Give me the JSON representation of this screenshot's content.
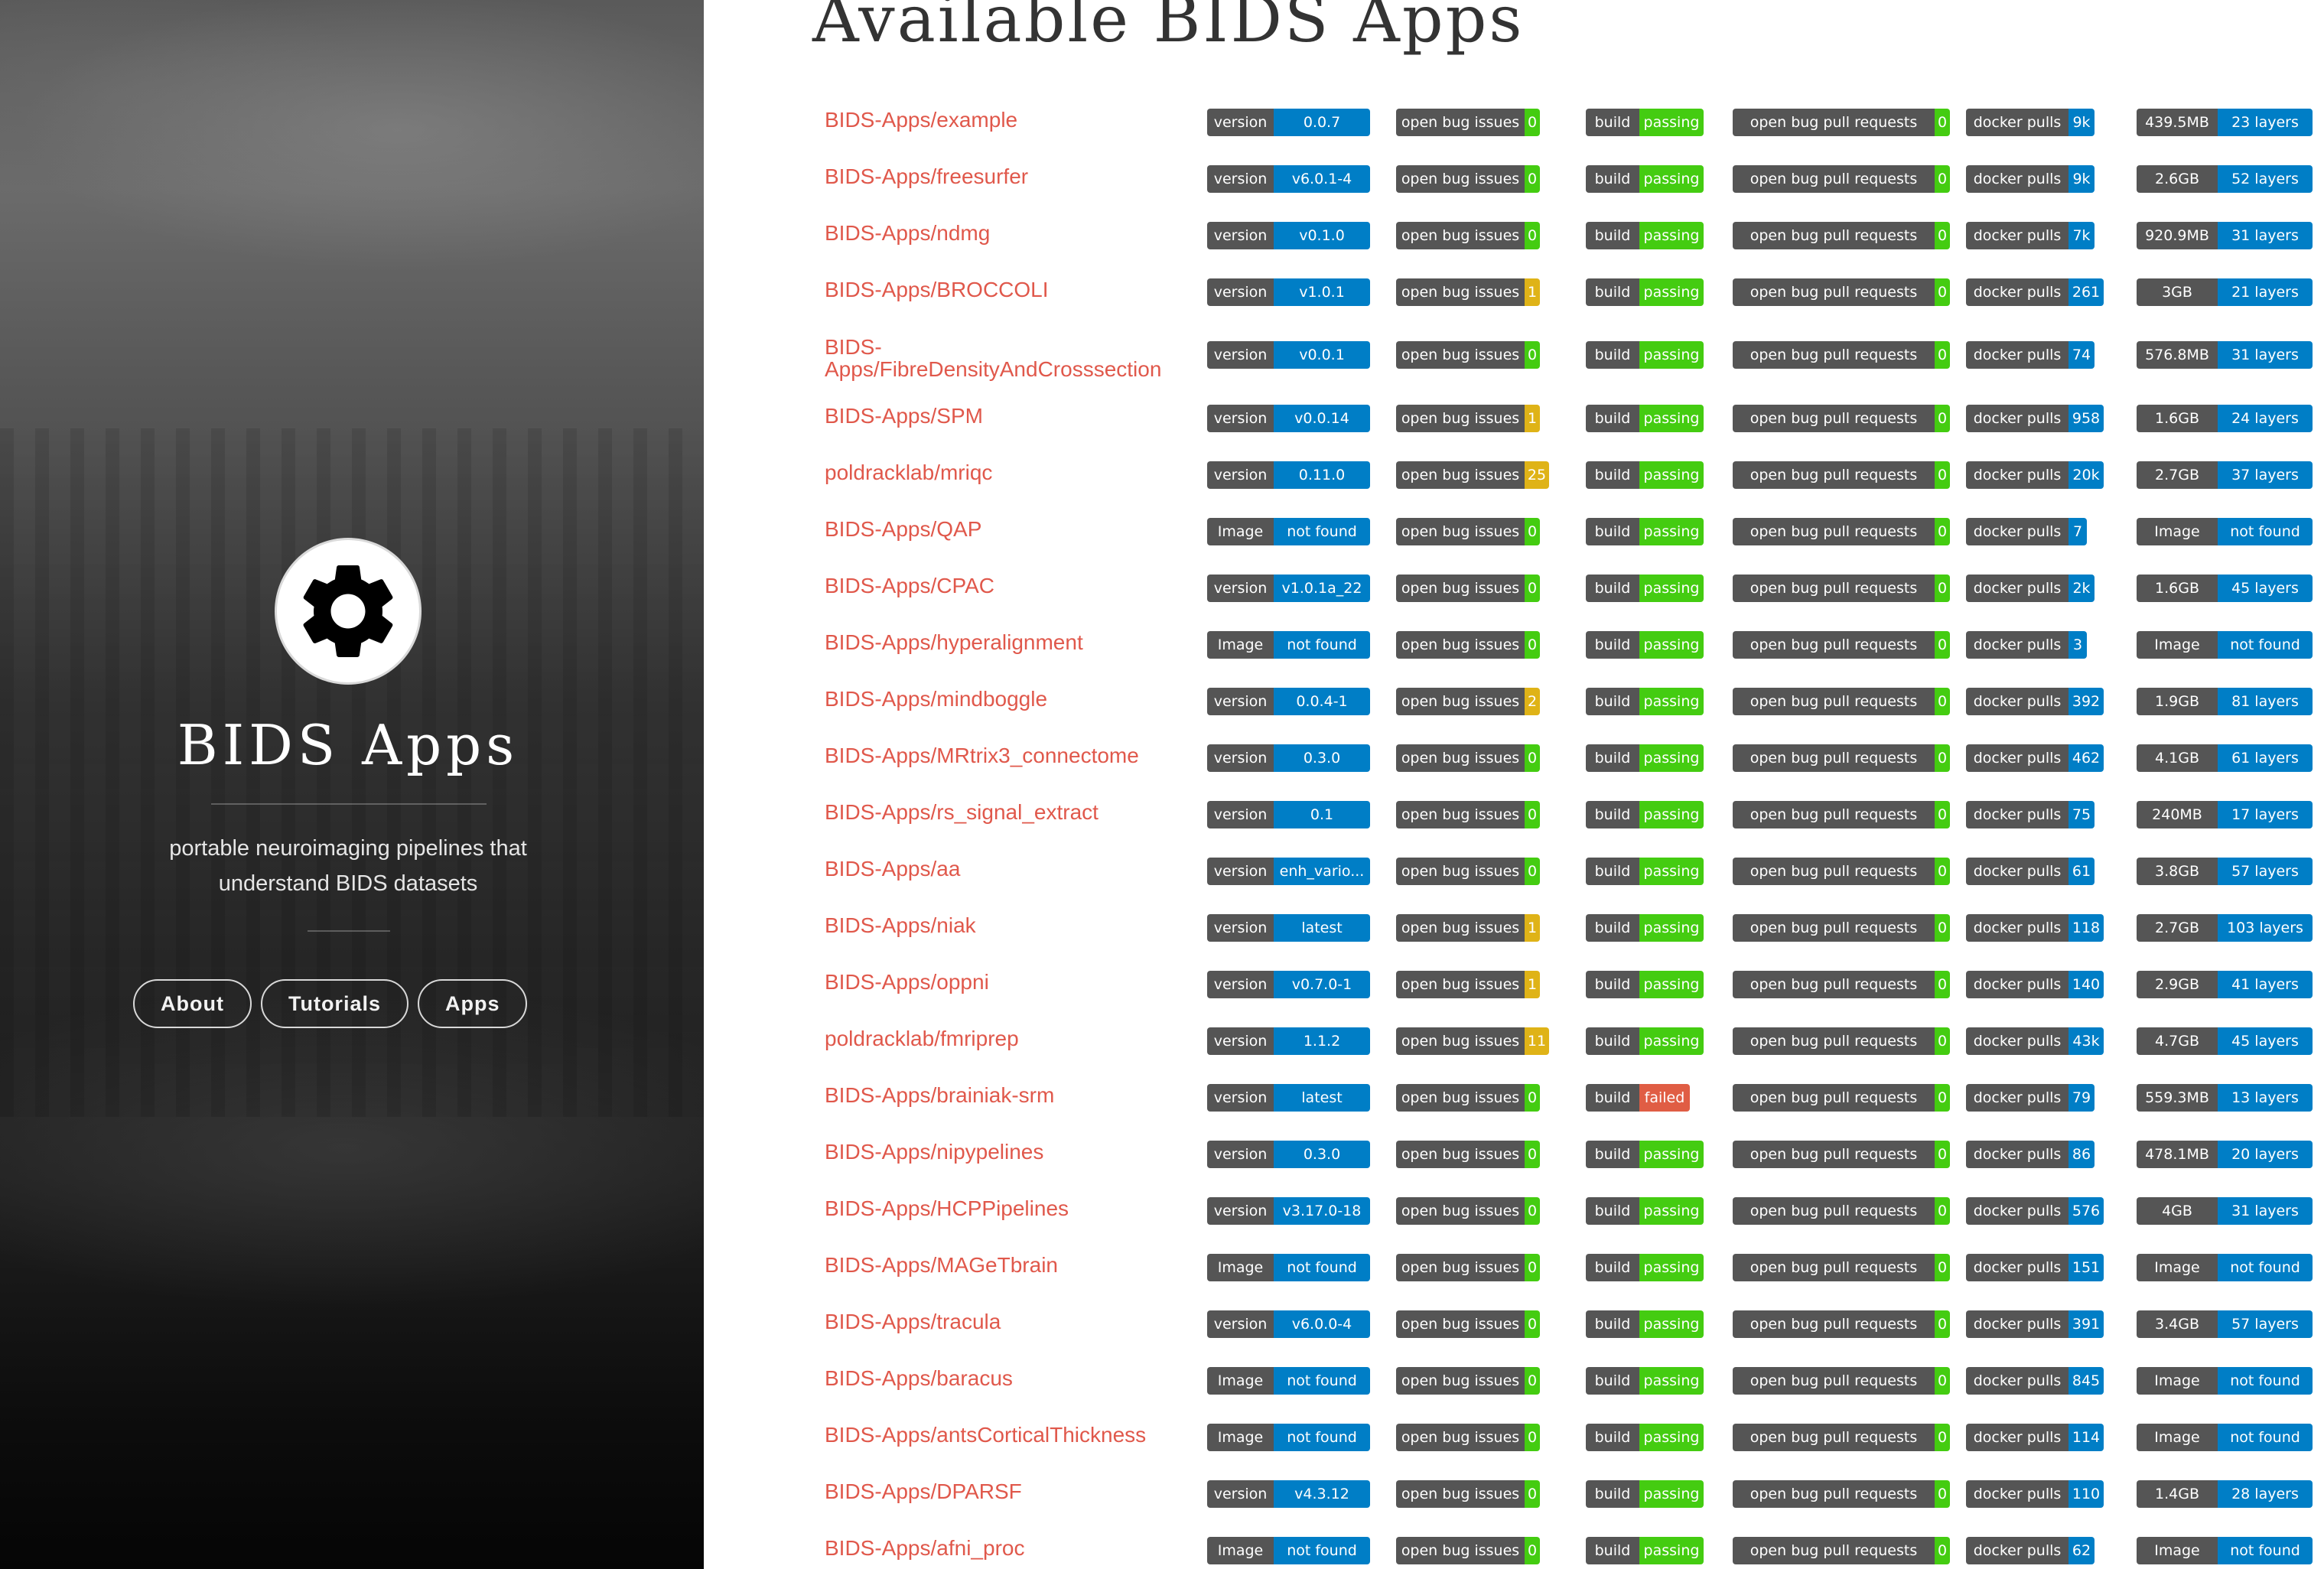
{
  "sidebar": {
    "title": "BIDS Apps",
    "tagline_line1": "portable neuroimaging pipelines that",
    "tagline_line2": "understand BIDS datasets",
    "nav": [
      {
        "label": "About"
      },
      {
        "label": "Tutorials"
      },
      {
        "label": "Apps"
      }
    ]
  },
  "main": {
    "title": "Available BIDS Apps",
    "badge_labels": {
      "version": "version",
      "image": "Image",
      "issues": "open bug issues",
      "build": "build",
      "prs": "open bug pull requests",
      "pulls": "docker pulls"
    },
    "colors": {
      "label_gray": "#555555",
      "blue": "#007ec6",
      "green": "#44cc11",
      "yellow": "#dfb317",
      "red": "#e05d44",
      "link": "#e0584b"
    },
    "apps": [
      {
        "name": "BIDS-Apps/example",
        "ver_label": "version",
        "ver": "0.0.7",
        "issues": "0",
        "build": "passing",
        "prs": "0",
        "pulls": "9k",
        "size": "439.5MB",
        "layers": "23 layers"
      },
      {
        "name": "BIDS-Apps/freesurfer",
        "ver_label": "version",
        "ver": "v6.0.1-4",
        "issues": "0",
        "build": "passing",
        "prs": "0",
        "pulls": "9k",
        "size": "2.6GB",
        "layers": "52 layers"
      },
      {
        "name": "BIDS-Apps/ndmg",
        "ver_label": "version",
        "ver": "v0.1.0",
        "issues": "0",
        "build": "passing",
        "prs": "0",
        "pulls": "7k",
        "size": "920.9MB",
        "layers": "31 layers"
      },
      {
        "name": "BIDS-Apps/BROCCOLI",
        "ver_label": "version",
        "ver": "v1.0.1",
        "issues": "1",
        "build": "passing",
        "prs": "0",
        "pulls": "261",
        "size": "3GB",
        "layers": "21 layers"
      },
      {
        "name": "BIDS-Apps/FibreDensityAndCrosssection",
        "name_line1": "BIDS-",
        "name_line2": "Apps/FibreDensityAndCrosssection",
        "ver_label": "version",
        "ver": "v0.0.1",
        "issues": "0",
        "build": "passing",
        "prs": "0",
        "pulls": "74",
        "size": "576.8MB",
        "layers": "31 layers"
      },
      {
        "name": "BIDS-Apps/SPM",
        "ver_label": "version",
        "ver": "v0.0.14",
        "issues": "1",
        "build": "passing",
        "prs": "0",
        "pulls": "958",
        "size": "1.6GB",
        "layers": "24 layers"
      },
      {
        "name": "poldracklab/mriqc",
        "ver_label": "version",
        "ver": "0.11.0",
        "issues": "25",
        "build": "passing",
        "prs": "0",
        "pulls": "20k",
        "size": "2.7GB",
        "layers": "37 layers"
      },
      {
        "name": "BIDS-Apps/QAP",
        "ver_label": "Image",
        "ver": "not found",
        "issues": "0",
        "build": "passing",
        "prs": "0",
        "pulls": "7",
        "size": "Image",
        "layers": "not found"
      },
      {
        "name": "BIDS-Apps/CPAC",
        "ver_label": "version",
        "ver": "v1.0.1a_22",
        "issues": "0",
        "build": "passing",
        "prs": "0",
        "pulls": "2k",
        "size": "1.6GB",
        "layers": "45 layers"
      },
      {
        "name": "BIDS-Apps/hyperalignment",
        "ver_label": "Image",
        "ver": "not found",
        "issues": "0",
        "build": "passing",
        "prs": "0",
        "pulls": "3",
        "size": "Image",
        "layers": "not found"
      },
      {
        "name": "BIDS-Apps/mindboggle",
        "ver_label": "version",
        "ver": "0.0.4-1",
        "issues": "2",
        "build": "passing",
        "prs": "0",
        "pulls": "392",
        "size": "1.9GB",
        "layers": "81 layers"
      },
      {
        "name": "BIDS-Apps/MRtrix3_connectome",
        "ver_label": "version",
        "ver": "0.3.0",
        "issues": "0",
        "build": "passing",
        "prs": "0",
        "pulls": "462",
        "size": "4.1GB",
        "layers": "61 layers"
      },
      {
        "name": "BIDS-Apps/rs_signal_extract",
        "ver_label": "version",
        "ver": "0.1",
        "issues": "0",
        "build": "passing",
        "prs": "0",
        "pulls": "75",
        "size": "240MB",
        "layers": "17 layers"
      },
      {
        "name": "BIDS-Apps/aa",
        "ver_label": "version",
        "ver": "enh_vario...",
        "issues": "0",
        "build": "passing",
        "prs": "0",
        "pulls": "61",
        "size": "3.8GB",
        "layers": "57 layers"
      },
      {
        "name": "BIDS-Apps/niak",
        "ver_label": "version",
        "ver": "latest",
        "issues": "1",
        "build": "passing",
        "prs": "0",
        "pulls": "118",
        "size": "2.7GB",
        "layers": "103 layers"
      },
      {
        "name": "BIDS-Apps/oppni",
        "ver_label": "version",
        "ver": "v0.7.0-1",
        "issues": "1",
        "build": "passing",
        "prs": "0",
        "pulls": "140",
        "size": "2.9GB",
        "layers": "41 layers"
      },
      {
        "name": "poldracklab/fmriprep",
        "ver_label": "version",
        "ver": "1.1.2",
        "issues": "11",
        "build": "passing",
        "prs": "0",
        "pulls": "43k",
        "size": "4.7GB",
        "layers": "45 layers"
      },
      {
        "name": "BIDS-Apps/brainiak-srm",
        "ver_label": "version",
        "ver": "latest",
        "issues": "0",
        "build": "failed",
        "prs": "0",
        "pulls": "79",
        "size": "559.3MB",
        "layers": "13 layers"
      },
      {
        "name": "BIDS-Apps/nipypelines",
        "ver_label": "version",
        "ver": "0.3.0",
        "issues": "0",
        "build": "passing",
        "prs": "0",
        "pulls": "86",
        "size": "478.1MB",
        "layers": "20 layers"
      },
      {
        "name": "BIDS-Apps/HCPPipelines",
        "ver_label": "version",
        "ver": "v3.17.0-18",
        "issues": "0",
        "build": "passing",
        "prs": "0",
        "pulls": "576",
        "size": "4GB",
        "layers": "31 layers"
      },
      {
        "name": "BIDS-Apps/MAGeTbrain",
        "ver_label": "Image",
        "ver": "not found",
        "issues": "0",
        "build": "passing",
        "prs": "0",
        "pulls": "151",
        "size": "Image",
        "layers": "not found"
      },
      {
        "name": "BIDS-Apps/tracula",
        "ver_label": "version",
        "ver": "v6.0.0-4",
        "issues": "0",
        "build": "passing",
        "prs": "0",
        "pulls": "391",
        "size": "3.4GB",
        "layers": "57 layers"
      },
      {
        "name": "BIDS-Apps/baracus",
        "ver_label": "Image",
        "ver": "not found",
        "issues": "0",
        "build": "passing",
        "prs": "0",
        "pulls": "845",
        "size": "Image",
        "layers": "not found"
      },
      {
        "name": "BIDS-Apps/antsCorticalThickness",
        "ver_label": "Image",
        "ver": "not found",
        "issues": "0",
        "build": "passing",
        "prs": "0",
        "pulls": "114",
        "size": "Image",
        "layers": "not found"
      },
      {
        "name": "BIDS-Apps/DPARSF",
        "ver_label": "version",
        "ver": "v4.3.12",
        "issues": "0",
        "build": "passing",
        "prs": "0",
        "pulls": "110",
        "size": "1.4GB",
        "layers": "28 layers"
      },
      {
        "name": "BIDS-Apps/afni_proc",
        "ver_label": "Image",
        "ver": "not found",
        "issues": "0",
        "build": "passing",
        "prs": "0",
        "pulls": "62",
        "size": "Image",
        "layers": "not found"
      }
    ]
  }
}
